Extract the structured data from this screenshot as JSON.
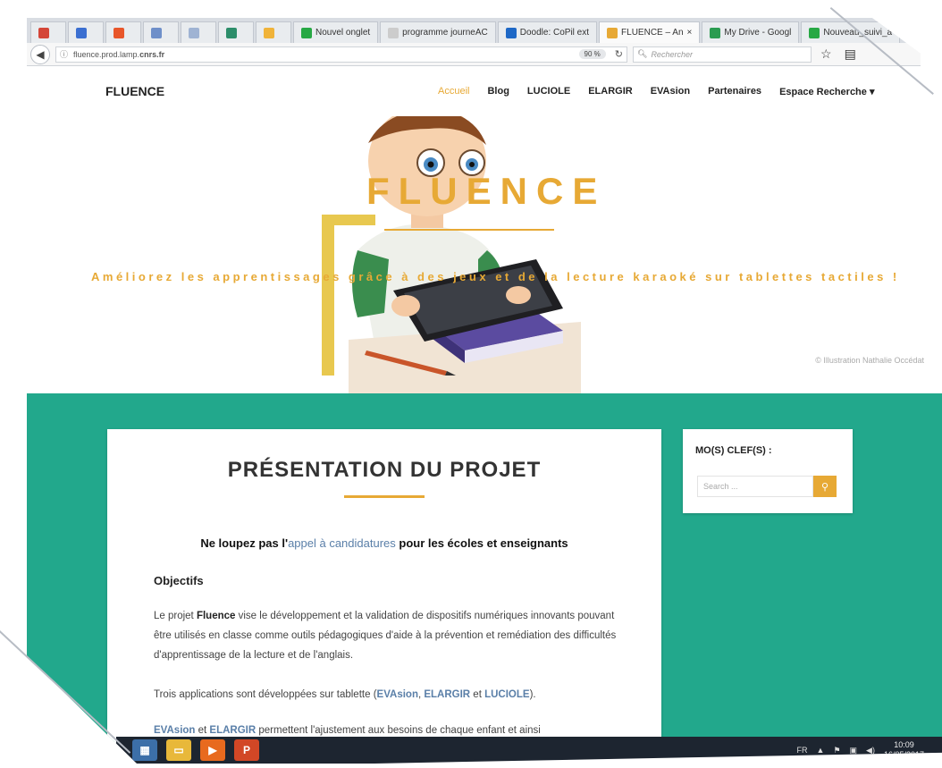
{
  "browser": {
    "tabs": [
      {
        "label": "",
        "color": "#d44638"
      },
      {
        "label": "",
        "color": "#3b6fd1"
      },
      {
        "label": "",
        "color": "#e8562a"
      },
      {
        "label": "",
        "color": "#6e8fc9"
      },
      {
        "label": "",
        "color": "#9fb3d3"
      },
      {
        "label": "",
        "color": "#2c8d6a"
      },
      {
        "label": "",
        "color": "#f0b33a"
      },
      {
        "label": "Nouvel onglet",
        "color": "#27a844"
      },
      {
        "label": "programme journeAC",
        "color": "#cccccc"
      },
      {
        "label": "Doodle: CoPil ext",
        "color": "#1e68c6"
      },
      {
        "label": "FLUENCE – An",
        "color": "#e7a935",
        "active": true
      },
      {
        "label": "My Drive - Googl",
        "color": "#2a9b50"
      },
      {
        "label": "Nouveau_suivi_a",
        "color": "#27a844"
      }
    ],
    "url_host": "fluence.prod.lamp.",
    "url_domain": "cnrs.fr",
    "zoom": "90 %",
    "search_placeholder": "Rechercher"
  },
  "site": {
    "brand": "FLUENCE",
    "menu": [
      {
        "label": "Accueil",
        "active": true
      },
      {
        "label": "Blog"
      },
      {
        "label": "LUCIOLE"
      },
      {
        "label": "ELARGIR"
      },
      {
        "label": "EVAsion"
      },
      {
        "label": "Partenaires"
      },
      {
        "label": "Espace Recherche ▾"
      }
    ]
  },
  "hero": {
    "title": "FLUENCE",
    "subtitle": "Améliorez les apprentissages grâce à des jeux et de la lecture karaoké sur tablettes tactiles !",
    "credit": "© Illustration Nathalie Occédat"
  },
  "content": {
    "title": "PRÉSENTATION DU PROJET",
    "callout_before": "Ne loupez pas l'",
    "callout_link": "appel à candidatures",
    "callout_after": " pour les écoles et enseignants",
    "objectives_heading": "Objectifs",
    "p1_before": "Le projet ",
    "p1_bold": "Fluence",
    "p1_after": " vise le développement et la validation de dispositifs numériques innovants pouvant être utilisés en classe comme outils pédagogiques d'aide à la prévention et remédiation des difficultés d'apprentissage de la lecture et de l'anglais.",
    "p2_before": "Trois applications sont développées sur tablette (",
    "p2_link1": "EVAsion",
    "p2_sep1": ", ",
    "p2_link2": "ELARGIR",
    "p2_sep2": " et ",
    "p2_link3": "LUCIOLE",
    "p2_after": ").",
    "p3_link1": "EVAsion",
    "p3_mid": " et ",
    "p3_link2": "ELARGIR",
    "p3_after": " permettent l'ajustement aux besoins de chaque enfant et ainsi"
  },
  "sidebar": {
    "title": "MO(S) CLEF(S) :",
    "search_placeholder": "Search ..."
  },
  "taskbar": {
    "lang": "FR",
    "time": "10:09",
    "date": "16/05/2017"
  },
  "colors": {
    "accent": "#e7a935",
    "teal": "#22a88c",
    "link": "#5a7fa8"
  }
}
